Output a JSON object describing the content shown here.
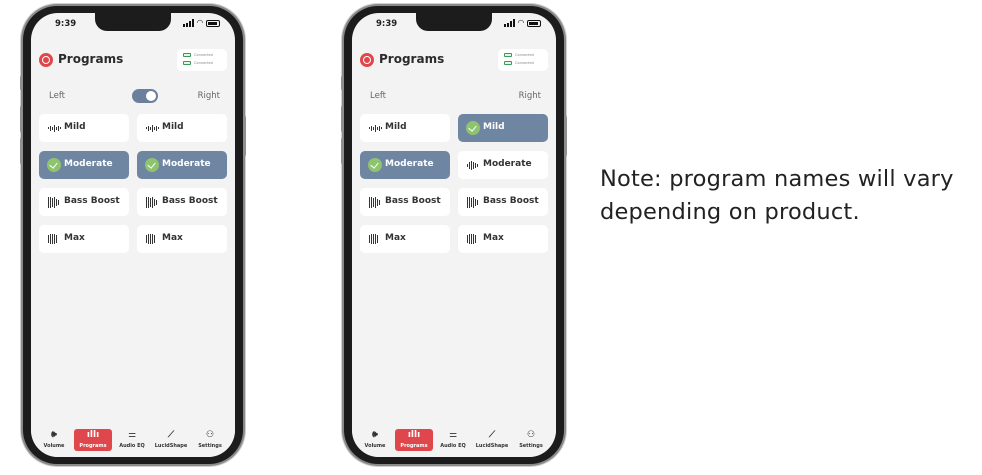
{
  "phones": [
    {
      "status": {
        "time": "9:39"
      },
      "header": {
        "title": "Programs",
        "conn_line1": "Connected",
        "conn_line2": "Connected"
      },
      "sides": {
        "left": "Left",
        "right": "Right",
        "toggle_on": true
      },
      "left_programs": [
        {
          "label": "Mild",
          "selected": false
        },
        {
          "label": "Moderate",
          "selected": true
        },
        {
          "label": "Bass Boost",
          "selected": false
        },
        {
          "label": "Max",
          "selected": false
        }
      ],
      "right_programs": [
        {
          "label": "Mild",
          "selected": false
        },
        {
          "label": "Moderate",
          "selected": true
        },
        {
          "label": "Bass Boost",
          "selected": false
        },
        {
          "label": "Max",
          "selected": false
        }
      ]
    },
    {
      "status": {
        "time": "9:39"
      },
      "header": {
        "title": "Programs",
        "conn_line1": "Connected",
        "conn_line2": "Connected"
      },
      "sides": {
        "left": "Left",
        "right": "Right",
        "toggle_on": false
      },
      "left_programs": [
        {
          "label": "Mild",
          "selected": false
        },
        {
          "label": "Moderate",
          "selected": true
        },
        {
          "label": "Bass Boost",
          "selected": false
        },
        {
          "label": "Max",
          "selected": false
        }
      ],
      "right_programs": [
        {
          "label": "Mild",
          "selected": true
        },
        {
          "label": "Moderate",
          "selected": false
        },
        {
          "label": "Bass Boost",
          "selected": false
        },
        {
          "label": "Max",
          "selected": false
        }
      ]
    }
  ],
  "tabs": [
    {
      "label": "Volume",
      "icon": "speaker-icon",
      "active": false
    },
    {
      "label": "Programs",
      "icon": "waveform-icon",
      "active": true
    },
    {
      "label": "Audio EQ",
      "icon": "sliders-icon",
      "active": false
    },
    {
      "label": "LucidShape",
      "icon": "chart-icon",
      "active": false
    },
    {
      "label": "Settings",
      "icon": "person-icon",
      "active": false
    }
  ],
  "note": {
    "line1": "Note: program names will vary",
    "line2": "depending on product."
  },
  "colors": {
    "accent": "#e0474c",
    "selected_button": "#6f86a3",
    "check": "#8fc46e",
    "toggle": "#6b809c"
  }
}
